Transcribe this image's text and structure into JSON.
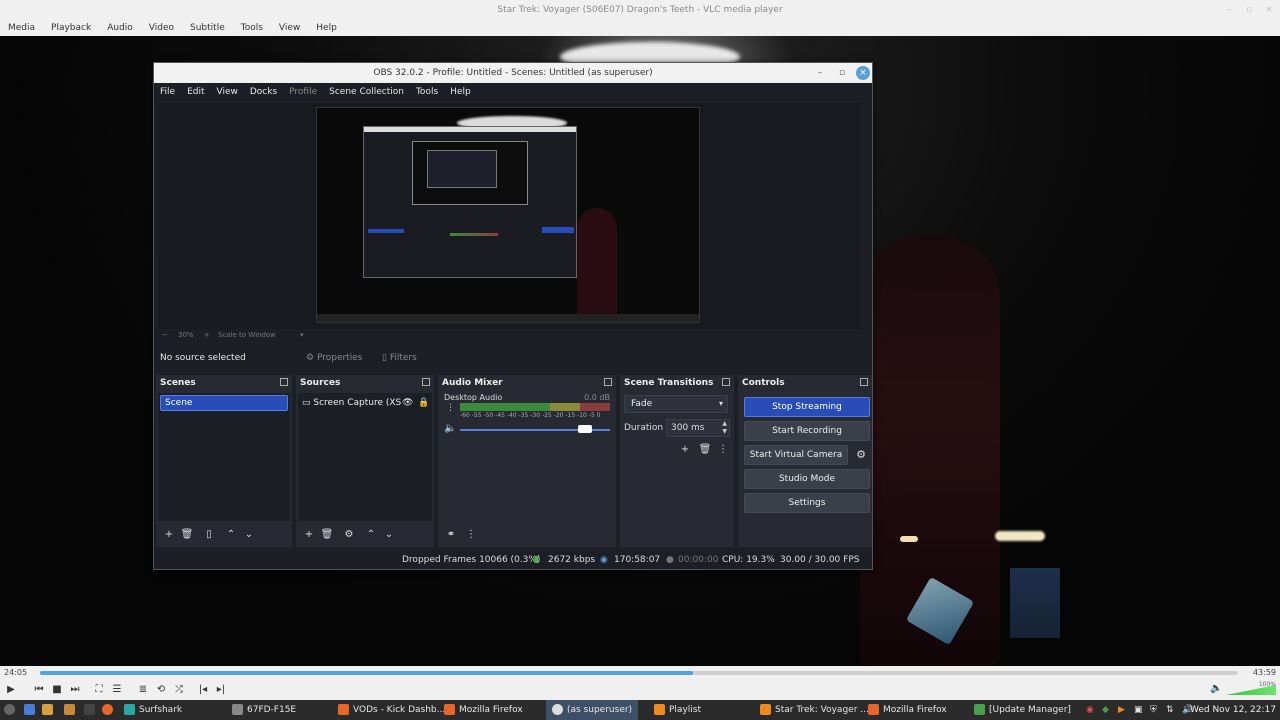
{
  "vlc": {
    "title": "Star Trek: Voyager (S06E07) Dragon's Teeth - VLC media player",
    "menu": [
      "Media",
      "Playback",
      "Audio",
      "Video",
      "Subtitle",
      "Tools",
      "View",
      "Help"
    ],
    "elapsed": "24:05",
    "remaining": "43:59",
    "progress": 0.545,
    "volume_percent": "100%",
    "volume_level": 1.0
  },
  "obs": {
    "title": "OBS 32.0.2 - Profile: Untitled - Scenes: Untitled (as superuser)",
    "menu": [
      "File",
      "Edit",
      "View",
      "Docks",
      "Profile",
      "Scene Collection",
      "Tools",
      "Help"
    ],
    "zoom": "30%",
    "scale_mode": "Scale to Window",
    "no_source": "No source selected",
    "properties_label": "Properties",
    "filters_label": "Filters",
    "docks": {
      "scenes": {
        "title": "Scenes",
        "items": [
          "Scene"
        ]
      },
      "sources": {
        "title": "Sources",
        "items": [
          "Screen Capture (XS"
        ]
      },
      "mixer": {
        "title": "Audio Mixer",
        "channel": "Desktop Audio",
        "db": "0.0 dB",
        "ticks": "-60 -55 -50 -45 -40 -35 -30 -25 -20 -15 -10 -5 0"
      },
      "transitions": {
        "title": "Scene Transitions",
        "selected": "Fade",
        "duration_label": "Duration",
        "duration_value": "300 ms"
      },
      "controls": {
        "title": "Controls",
        "stop_streaming": "Stop Streaming",
        "start_recording": "Start Recording",
        "start_virtual_camera": "Start Virtual Camera",
        "studio_mode": "Studio Mode",
        "settings": "Settings"
      }
    },
    "status": {
      "dropped": "Dropped Frames 10066 (0.3%)",
      "bitrate": "2672 kbps",
      "stream_time": "170:58:07",
      "rec_time": "00:00:00",
      "cpu": "CPU: 19.3%",
      "fps": "30.00 / 30.00 FPS"
    }
  },
  "taskbar": {
    "items": [
      "Surfshark",
      "67FD-F15E",
      "VODs - Kick Dashb...",
      "Mozilla Firefox",
      "(as superuser)",
      "Playlist",
      "Star Trek: Voyager ...",
      "Mozilla Firefox",
      "[Update Manager]"
    ],
    "clock": "Wed Nov 12, 22:17"
  }
}
